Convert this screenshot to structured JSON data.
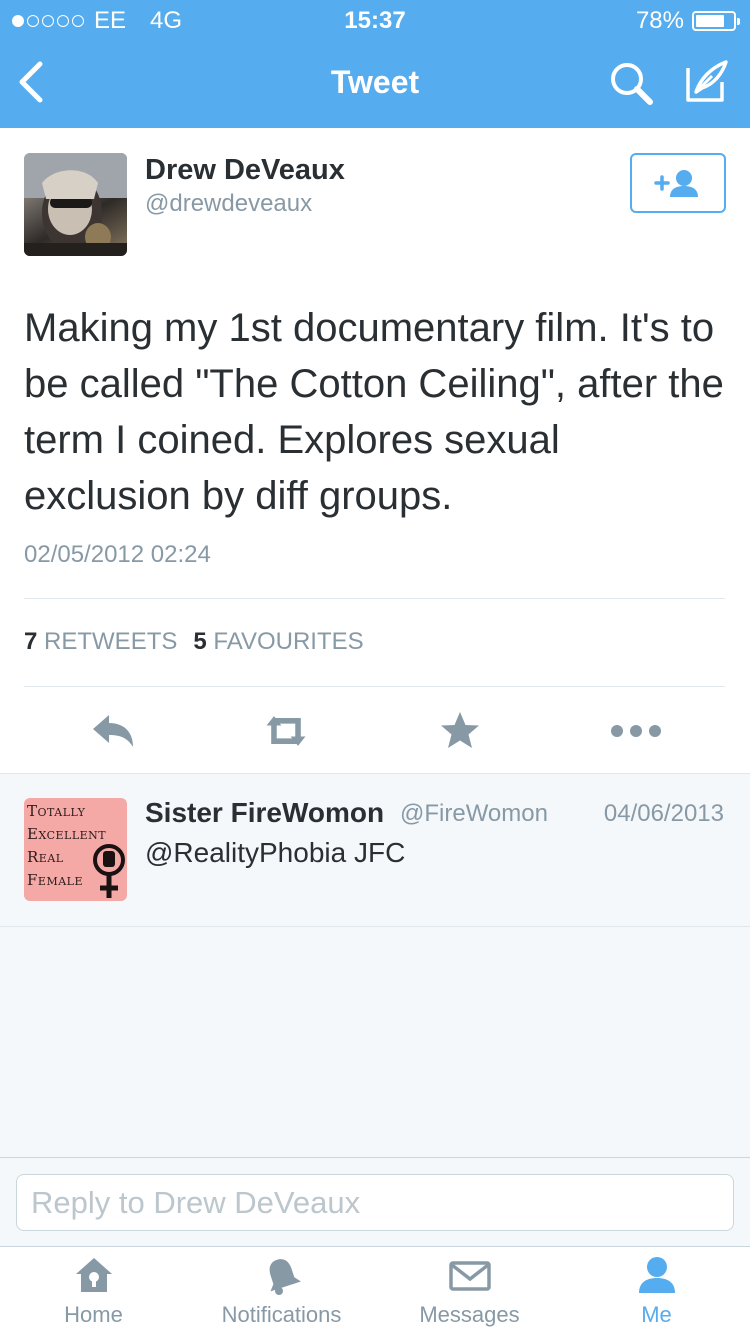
{
  "status_bar": {
    "carrier": "EE",
    "network": "4G",
    "time": "15:37",
    "battery_text": "78%",
    "battery_level": 0.78,
    "signal_bars": 1
  },
  "nav": {
    "title": "Tweet",
    "back_icon": "chevron-left-icon",
    "search_icon": "search-icon",
    "compose_icon": "compose-icon"
  },
  "tweet": {
    "author_name": "Drew DeVeaux",
    "author_handle": "@drewdeveaux",
    "text": "Making my 1st documentary film. It's to be called \"The Cotton Ceiling\", after the term I coined. Explores sexual exclusion by diff groups.",
    "date": "02/05/2012 02:24",
    "retweet_count": "7",
    "retweet_label": "RETWEETS",
    "favourite_count": "5",
    "favourite_label": "FAVOURITES",
    "follow_icon": "add-user-icon"
  },
  "reply": {
    "name": "Sister FireWomon",
    "handle": "@FireWomon",
    "date": "04/06/2013",
    "text": "@RealityPhobia JFC",
    "avatar_lines": [
      {
        "cap": "T",
        "rest": "OTALLY"
      },
      {
        "cap": "E",
        "rest": "XCELLENT"
      },
      {
        "cap": "R",
        "rest": "EAL"
      },
      {
        "cap": "F",
        "rest": "EMALE"
      }
    ]
  },
  "composer": {
    "placeholder": "Reply to Drew DeVeaux"
  },
  "tabs": [
    {
      "label": "Home",
      "icon": "home-icon"
    },
    {
      "label": "Notifications",
      "icon": "bell-icon"
    },
    {
      "label": "Messages",
      "icon": "envelope-icon"
    },
    {
      "label": "Me",
      "icon": "person-icon",
      "active": true
    }
  ],
  "colors": {
    "brand": "#55acee",
    "icon_gray": "#8899a6",
    "text": "#292f33"
  }
}
